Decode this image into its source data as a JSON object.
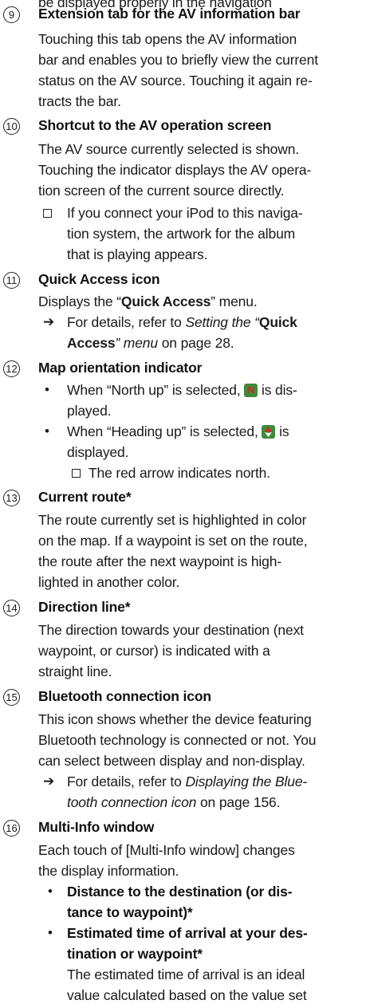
{
  "top_fragment": "be displayed properly in the navigation",
  "items": [
    {
      "num": "9",
      "title": "Extension tab for the AV information bar"
    },
    {
      "num": "10",
      "title": "Shortcut to the AV operation screen"
    },
    {
      "num": "11",
      "title": "Quick Access icon"
    },
    {
      "num": "12",
      "title": "Map orientation indicator"
    },
    {
      "num": "13",
      "title": "Current route*"
    },
    {
      "num": "14",
      "title": "Direction line*"
    },
    {
      "num": "15",
      "title": "Bluetooth connection icon"
    },
    {
      "num": "16",
      "title": "Multi-Info window"
    }
  ],
  "text": {
    "i9_l1": "Touching this tab opens the AV information",
    "i9_l2": "bar and enables you to briefly view the current",
    "i9_l3": "status on the AV source. Touching it again re-",
    "i9_l4": "tracts the bar.",
    "i10_l1": "The AV source currently selected is shown.",
    "i10_l2": "Touching the indicator displays the AV opera-",
    "i10_l3": "tion screen of the current source directly.",
    "i10_note_l1": "If you connect your iPod to this naviga-",
    "i10_note_l2": "tion system, the artwork for the album",
    "i10_note_l3": "that is playing appears.",
    "i11_l1_a": "Displays the “",
    "i11_l1_b": "Quick Access",
    "i11_l1_c": "” menu.",
    "i11_ref_a": "For details, refer to ",
    "i11_ref_b": "Setting the “",
    "i11_ref_c": "Quick",
    "i11_ref_d": "Access",
    "i11_ref_e": "” menu",
    "i11_ref_f": " on page 28.",
    "i12_b1_a": "When “North up” is selected, ",
    "i12_b1_b": " is dis-",
    "i12_b1_l2": "played.",
    "i12_b2_a": "When “Heading up” is selected, ",
    "i12_b2_b": " is",
    "i12_b2_l2": "displayed.",
    "i12_note": "The red arrow indicates north.",
    "i13_l1": "The route currently set is highlighted in color",
    "i13_l2": "on the map. If a waypoint is set on the route,",
    "i13_l3": "the route after the next waypoint is high-",
    "i13_l4": "lighted in another color.",
    "i14_l1": "The direction towards your destination (next",
    "i14_l2": "waypoint, or cursor) is indicated with a",
    "i14_l3": "straight line.",
    "i15_l1": "This icon shows whether the device featuring",
    "i15_l2": "Bluetooth technology is connected or not. You",
    "i15_l3": "can select between display and non-display.",
    "i15_ref_a": "For details, refer to ",
    "i15_ref_b": "Displaying the Blue-",
    "i15_ref_c": "tooth connection icon",
    "i15_ref_d": " on page 156.",
    "i16_l1": "Each touch of [Multi-Info window] changes",
    "i16_l2": "the display information.",
    "i16_b1_l1": "Distance to the destination (or dis-",
    "i16_b1_l2": "tance to waypoint)*",
    "i16_b2_l1": "Estimated time of arrival at your des-",
    "i16_b2_l2": "tination or waypoint*",
    "i16_b2_t1": "The estimated time of arrival is an ideal",
    "i16_b2_t2": "value calculated based on the value set"
  },
  "symbols": {
    "reference_arrow": "➔",
    "bullet": "•",
    "note_box": "checkbox-square",
    "north_up_icon": "north-up-icon",
    "heading_up_icon": "heading-up-icon",
    "colors": {
      "icon_green": "#3d8b3a",
      "icon_red": "#e0202a"
    }
  }
}
